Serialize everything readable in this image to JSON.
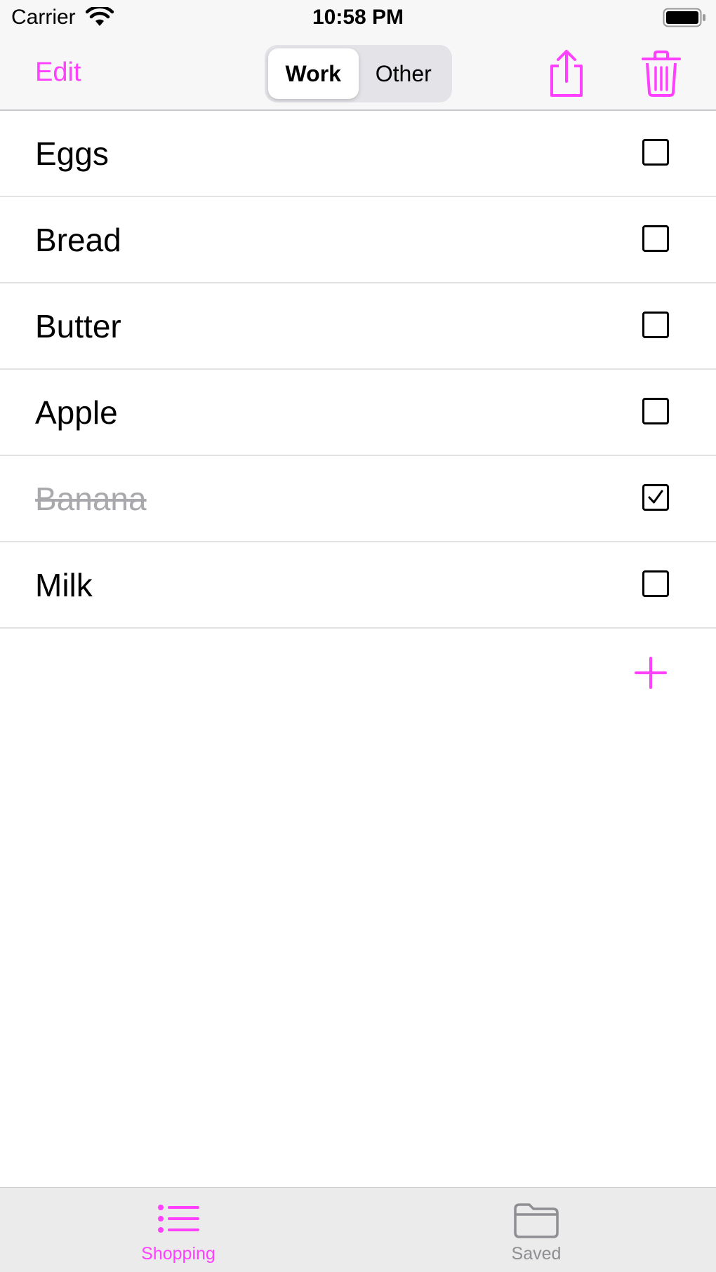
{
  "status_bar": {
    "carrier": "Carrier",
    "time": "10:58 PM"
  },
  "nav": {
    "edit_label": "Edit",
    "segments": [
      {
        "label": "Work",
        "selected": true
      },
      {
        "label": "Other",
        "selected": false
      }
    ]
  },
  "list": {
    "items": [
      {
        "label": "Eggs",
        "checked": false
      },
      {
        "label": "Bread",
        "checked": false
      },
      {
        "label": "Butter",
        "checked": false
      },
      {
        "label": "Apple",
        "checked": false
      },
      {
        "label": "Banana",
        "checked": true
      },
      {
        "label": "Milk",
        "checked": false
      }
    ]
  },
  "tab_bar": {
    "tabs": [
      {
        "label": "Shopping",
        "icon": "list-icon",
        "selected": true
      },
      {
        "label": "Saved",
        "icon": "folder-icon",
        "selected": false
      }
    ]
  },
  "colors": {
    "accent": "#ff40ff",
    "inactive": "#8e8e93",
    "done_text": "#a9a9ad"
  }
}
